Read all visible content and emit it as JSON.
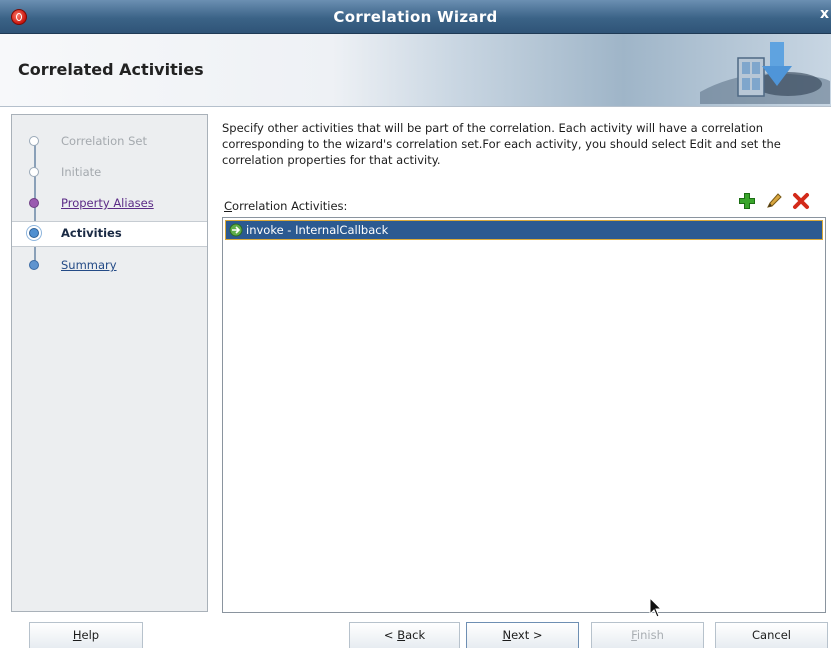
{
  "window": {
    "title": "Correlation Wizard",
    "app_icon": "oracle-icon",
    "close_glyph": "x"
  },
  "header": {
    "title": "Correlated Activities",
    "graphic_icon": "wizard-banner-icon"
  },
  "steps": [
    {
      "label": "Correlation Set",
      "state": "done"
    },
    {
      "label": "Initiate",
      "state": "done"
    },
    {
      "label": "Property Aliases",
      "state": "visited"
    },
    {
      "label": "Activities",
      "state": "current"
    },
    {
      "label": "Summary",
      "state": "next"
    }
  ],
  "main": {
    "description": "Specify other activities that will be part of the correlation. Each activity will have a correlation corresponding to the wizard's correlation set.For each activity, you should select Edit and set the correlation properties for that activity.",
    "list_label_mnemonic": "C",
    "list_label_rest": "orrelation Activities:",
    "toolbar": {
      "add_icon": "add-icon",
      "edit_icon": "edit-icon",
      "delete_icon": "delete-icon"
    },
    "rows": [
      {
        "icon": "invoke-icon",
        "text": "invoke - InternalCallback",
        "selected": true
      }
    ]
  },
  "buttons": {
    "help": {
      "mnemonic": "H",
      "rest": "elp"
    },
    "back": {
      "prefix": "< ",
      "mnemonic": "B",
      "rest": "ack"
    },
    "next": {
      "mnemonic": "N",
      "rest": "ext >"
    },
    "finish": {
      "mnemonic": "F",
      "rest": "inish",
      "disabled": true
    },
    "cancel": {
      "label": "Cancel"
    }
  },
  "colors": {
    "titlebar": "#3b6387",
    "selection": "#2c5a91",
    "selection_border": "#d9a93a",
    "link_visited": "#5b2a86",
    "link": "#234a86"
  }
}
